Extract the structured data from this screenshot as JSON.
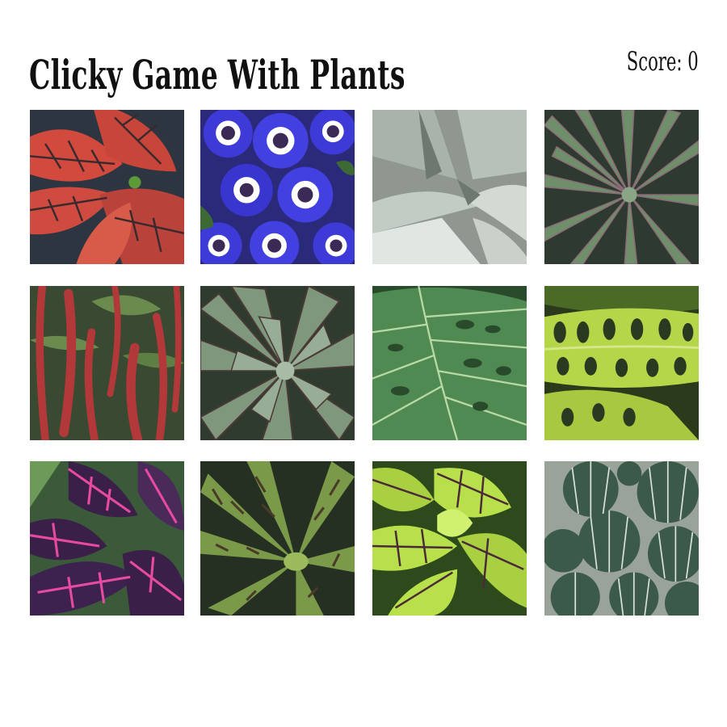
{
  "header": {
    "title": "Clicky Game With Plants",
    "score_label": "Score: 0"
  },
  "tiles": [
    {
      "id": "croton",
      "icon": "croton-leaf-image",
      "colors": {
        "bg": "#2c3540",
        "leaf": "#d24a3e",
        "vein": "#3a2a2e"
      }
    },
    {
      "id": "cineraria",
      "icon": "blue-flower-image",
      "colors": {
        "bg": "#2b2a7a",
        "petal": "#3d3ad8",
        "center": "#3a2a55",
        "ring": "#ffffff"
      }
    },
    {
      "id": "agave",
      "icon": "agave-image",
      "colors": {
        "bg": "#8f9790",
        "leaf": "#c3ccc4",
        "shadow": "#6e7770"
      }
    },
    {
      "id": "spiky-succulent",
      "icon": "spiky-succulent-image",
      "colors": {
        "bg": "#2e3a30",
        "leaf": "#6f8f6a",
        "edge": "#8a6b77"
      }
    },
    {
      "id": "chenille",
      "icon": "chenille-plant-image",
      "colors": {
        "bg": "#3a4a32",
        "tassel": "#b2383a",
        "leaf": "#6a8a4e"
      }
    },
    {
      "id": "echeveria",
      "icon": "echeveria-rosette-image",
      "colors": {
        "bg": "#2f3b2f",
        "leaf": "#7f977c",
        "tip": "#4a3a35"
      }
    },
    {
      "id": "monstera",
      "icon": "monstera-leaf-image",
      "colors": {
        "bg": "#2a4a2c",
        "leaf": "#4f8a52",
        "vein": "#b9d8a8"
      }
    },
    {
      "id": "prayer-plant",
      "icon": "prayer-plant-image",
      "colors": {
        "bg": "#2a3a1a",
        "leaf": "#b6d64a",
        "spot": "#2a3a20"
      }
    },
    {
      "id": "coleus-pink",
      "icon": "pink-coleus-image",
      "colors": {
        "bg": "#3a5a3a",
        "leaf": "#3a2048",
        "vein": "#e84aa0"
      }
    },
    {
      "id": "bromeliad",
      "icon": "bromeliad-image",
      "colors": {
        "bg": "#263022",
        "leaf": "#7a9a4a",
        "stripe": "#4a3a28"
      }
    },
    {
      "id": "coleus-lime",
      "icon": "lime-coleus-image",
      "colors": {
        "bg": "#2e4a1c",
        "leaf": "#b8e04a",
        "vein": "#4a2a3a"
      }
    },
    {
      "id": "cactus",
      "icon": "ball-cactus-image",
      "colors": {
        "bg": "#9aa39a",
        "body": "#3c5a4a",
        "rib": "#d8e0d8"
      }
    }
  ]
}
